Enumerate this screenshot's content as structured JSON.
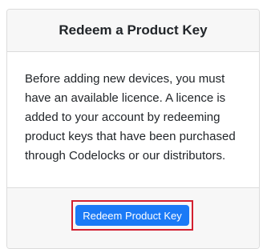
{
  "card": {
    "title": "Redeem a Product Key",
    "body_text": "Before adding new devices, you must have an available licence. A licence is added to your account by redeeming product keys that have been purchased through Codelocks or our distributors.",
    "button_label": "Redeem Product Key"
  },
  "colors": {
    "button_background": "#1b7af6",
    "highlight_border": "#d32030",
    "header_background": "#f7f7f7"
  }
}
